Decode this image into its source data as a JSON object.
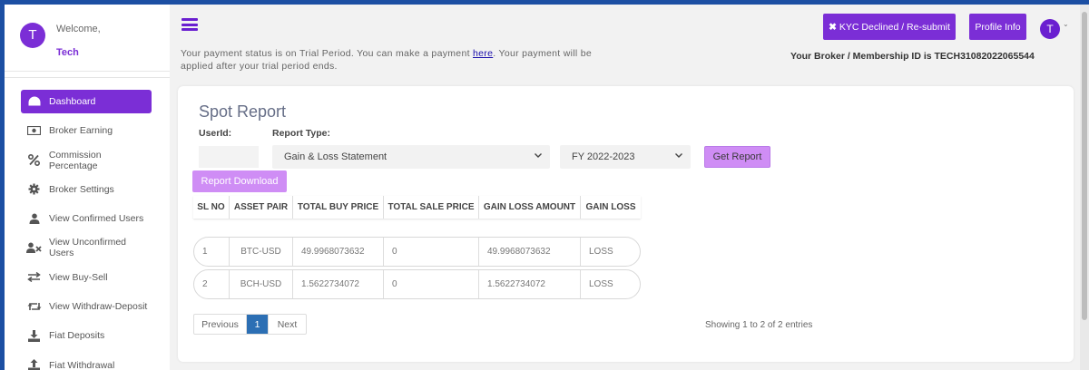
{
  "colors": {
    "accent": "#7b2ed6",
    "light_accent": "#cf8df5",
    "page_active": "#2c6fb4",
    "frame": "#1c4fa3"
  },
  "sidebar": {
    "avatar_letter": "T",
    "welcome": "Welcome,",
    "username": "Tech",
    "items": [
      {
        "label": "Dashboard",
        "icon": "dashboard-gauge-icon"
      },
      {
        "label": "Broker Earning",
        "icon": "money-bill-icon"
      },
      {
        "label": "Commission Percentage",
        "icon": "percent-icon"
      },
      {
        "label": "Broker Settings",
        "icon": "cog-icon"
      },
      {
        "label": "View Confirmed Users",
        "icon": "user-icon"
      },
      {
        "label": "View Unconfirmed Users",
        "icon": "users-x-icon"
      },
      {
        "label": "View Buy-Sell",
        "icon": "exchange-arrows-icon"
      },
      {
        "label": "View Withdraw-Deposit",
        "icon": "retweet-icon"
      },
      {
        "label": "Fiat Deposits",
        "icon": "download-tray-icon"
      },
      {
        "label": "Fiat Withdrawal",
        "icon": "upload-tray-icon"
      }
    ]
  },
  "header": {
    "notice_before": "Your payment status is on Trial Period. You can make a payment ",
    "notice_link": "here",
    "notice_after": ". Your payment will be applied after your trial period ends.",
    "kyc_button": "KYC Declined / Re-submit",
    "profile_button": "Profile Info",
    "avatar_letter": "T",
    "broker_id": "Your Broker / Membership ID is TECH31082022065544"
  },
  "report": {
    "title": "Spot Report",
    "userid_label": "UserId:",
    "report_type_label": "Report Type:",
    "report_type_value": "Gain & Loss Statement",
    "fy_value": "FY 2022-2023",
    "get_report": "Get Report",
    "download": "Report Download",
    "columns": [
      "SL NO",
      "ASSET PAIR",
      "TOTAL BUY PRICE",
      "TOTAL SALE PRICE",
      "GAIN LOSS AMOUNT",
      "GAIN LOSS"
    ],
    "rows": [
      [
        "1",
        "BTC-USD",
        "49.9968073632",
        "0",
        "49.9968073632",
        "LOSS"
      ],
      [
        "2",
        "BCH-USD",
        "1.5622734072",
        "0",
        "1.5622734072",
        "LOSS"
      ]
    ],
    "pagination": {
      "previous": "Previous",
      "current": "1",
      "next": "Next"
    },
    "showing": "Showing 1 to 2 of 2 entries"
  }
}
